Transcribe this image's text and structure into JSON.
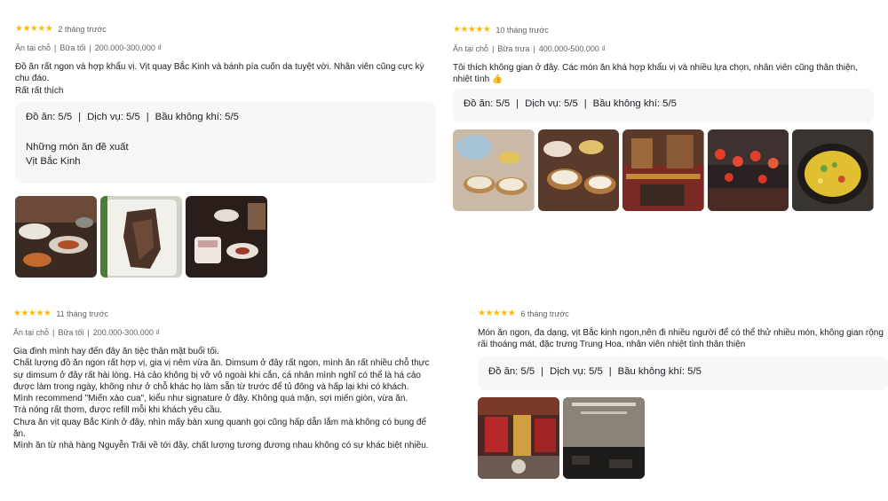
{
  "reviews": [
    {
      "stars": "★★★★★",
      "time": "2 tháng trước",
      "meta": [
        "Ăn tại chỗ",
        "Bữa tối",
        "200.000-300.000 ₫"
      ],
      "text": [
        "Đồ ăn rất ngon và hợp khẩu vị. Vịt quay Bắc Kinh và bánh pía cuốn da tuyệt vời. Nhân viên cũng cực kỳ chu đáo.",
        "Rất rất thích"
      ],
      "ratings": [
        "Đồ ăn: 5/5",
        "Dịch vụ: 5/5",
        "Bầu không khí: 5/5"
      ],
      "rec_title": "Những món ăn đề xuất",
      "rec_item": "Vịt Bắc Kinh"
    },
    {
      "stars": "★★★★★",
      "time": "10 tháng trước",
      "meta": [
        "Ăn tại chỗ",
        "Bữa trưa",
        "400.000-500.000 ₫"
      ],
      "text": [
        "Tôi thích không gian ở đây. Các món ăn khá hợp khẩu vị và nhiều lựa chọn, nhân viên cũng thân thiện, nhiệt tình 👍"
      ],
      "ratings": [
        "Đồ ăn: 5/5",
        "Dịch vụ: 5/5",
        "Bầu không khí: 5/5"
      ]
    },
    {
      "stars": "★★★★★",
      "time": "11 tháng trước",
      "meta": [
        "Ăn tại chỗ",
        "Bữa tối",
        "200.000-300.000 ₫"
      ],
      "text": [
        "Gia đình mình hay đến đây ăn tiệc thân mật buổi tối.",
        "Chất lượng đồ ăn ngon rất hợp vị, gia vị nêm vừa ăn. Dimsum ở đây rất ngon, mình ăn rất nhiều chỗ thực sự dimsum ở đây rất hài lòng. Há cảo không bị vỡ vỏ ngoài khi cắn, cá nhân mình nghĩ có thể là há cảo được làm trong ngày, không như ở chỗ khác họ làm sẵn từ trước để tủ đông và hấp lại khi có khách.",
        "Mình recommend \"Miến xào cua\", kiểu như signature ở đây. Không quá mặn, sợi miến giòn, vừa ăn.",
        "Trà nóng rất thơm, được refill mỗi khi khách yêu cầu.",
        "Chưa ăn vịt quay Bắc Kinh ở đây, nhìn mấy bàn xung quanh gọi cũng hấp dẫn lắm mà không có bụng để ăn.",
        "Mình ăn từ nhà hàng Nguyễn Trãi về tới đây, chất lượng tương đương nhau không có sự khác biệt nhiều."
      ]
    },
    {
      "stars": "★★★★★",
      "time": "6 tháng trước",
      "text": [
        "Món ăn ngon, đa dạng, vịt Bắc kinh ngon,nên đi nhiều người để có thể thử nhiều món, không gian rộng rãi thoáng mát, đặc trưng Trung Hoa, nhân viên nhiệt tình thân thiện"
      ],
      "ratings": [
        "Đồ ăn: 5/5",
        "Dịch vụ: 5/5",
        "Bầu không khí: 5/5"
      ]
    }
  ],
  "colors": {
    "star": "#fbbc04",
    "panel": "#f6f7f8",
    "meta_text": "#5f6368"
  }
}
